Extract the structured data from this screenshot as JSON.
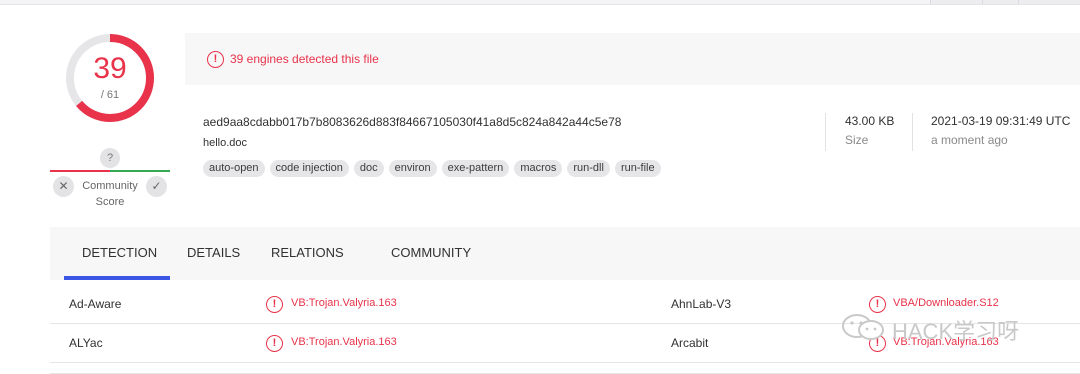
{
  "score": {
    "detected": "39",
    "total": "/ 61"
  },
  "community": {
    "badge": "?",
    "label_line1": "Community",
    "label_line2": "Score",
    "down_icon": "✕",
    "up_icon": "✓"
  },
  "banner": {
    "icon": "!",
    "text": "39 engines detected this file"
  },
  "file": {
    "hash": "aed9aa8cdabb017b7b8083626d883f84667105030f41a8d5c824a842a44c5e78",
    "name": "hello.doc",
    "tags": [
      "auto-open",
      "code injection",
      "doc",
      "environ",
      "exe-pattern",
      "macros",
      "run-dll",
      "run-file"
    ],
    "size_value": "43.00 KB",
    "size_label": "Size",
    "date_value": "2021-03-19 09:31:49 UTC",
    "date_label": "a moment ago"
  },
  "tabs": [
    "DETECTION",
    "DETAILS",
    "RELATIONS",
    "COMMUNITY"
  ],
  "results": [
    {
      "engine": "Ad-Aware",
      "result": "VB:Trojan.Valyria.163",
      "engine2": "AhnLab-V3",
      "result2": "VBA/Downloader.S12"
    },
    {
      "engine": "ALYac",
      "result": "VB:Trojan.Valyria.163",
      "engine2": "Arcabit",
      "result2": "VB:Trojan.Valyria.163"
    }
  ],
  "watermark": {
    "text": "HACK学习呀"
  },
  "colors": {
    "alert": "#e8334a",
    "accent": "#3b57e5",
    "positive": "#34a853"
  }
}
